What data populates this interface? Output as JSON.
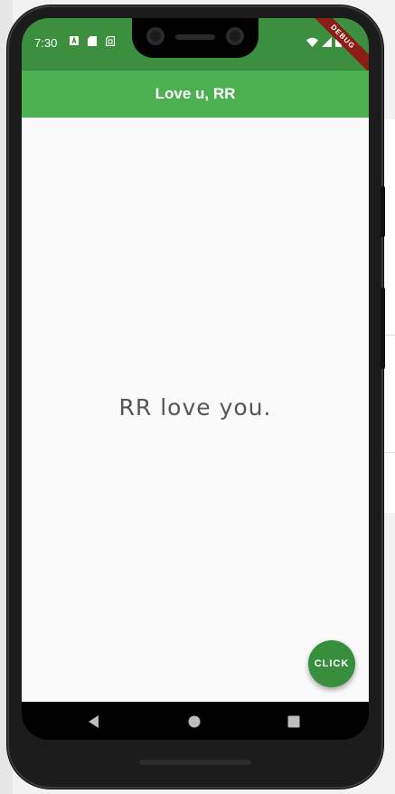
{
  "status_bar": {
    "time": "7:30",
    "icons_left": [
      "a-notification-icon",
      "sd-card-icon",
      "sim-icon"
    ],
    "icons_right": [
      "wifi-icon",
      "signal-icon",
      "battery-icon"
    ]
  },
  "debug_banner": "DEBUG",
  "app_bar": {
    "title": "Love u, RR"
  },
  "body": {
    "message": "RR love you."
  },
  "fab": {
    "label": "CLICK"
  },
  "nav": {
    "items": [
      "back-icon",
      "home-icon",
      "recents-icon"
    ]
  },
  "colors": {
    "app_bar": "#4caf50",
    "status_bar": "#3b8f3e",
    "fab": "#388e3c",
    "body_bg": "#fafafa",
    "debug": "#8b1d16"
  }
}
